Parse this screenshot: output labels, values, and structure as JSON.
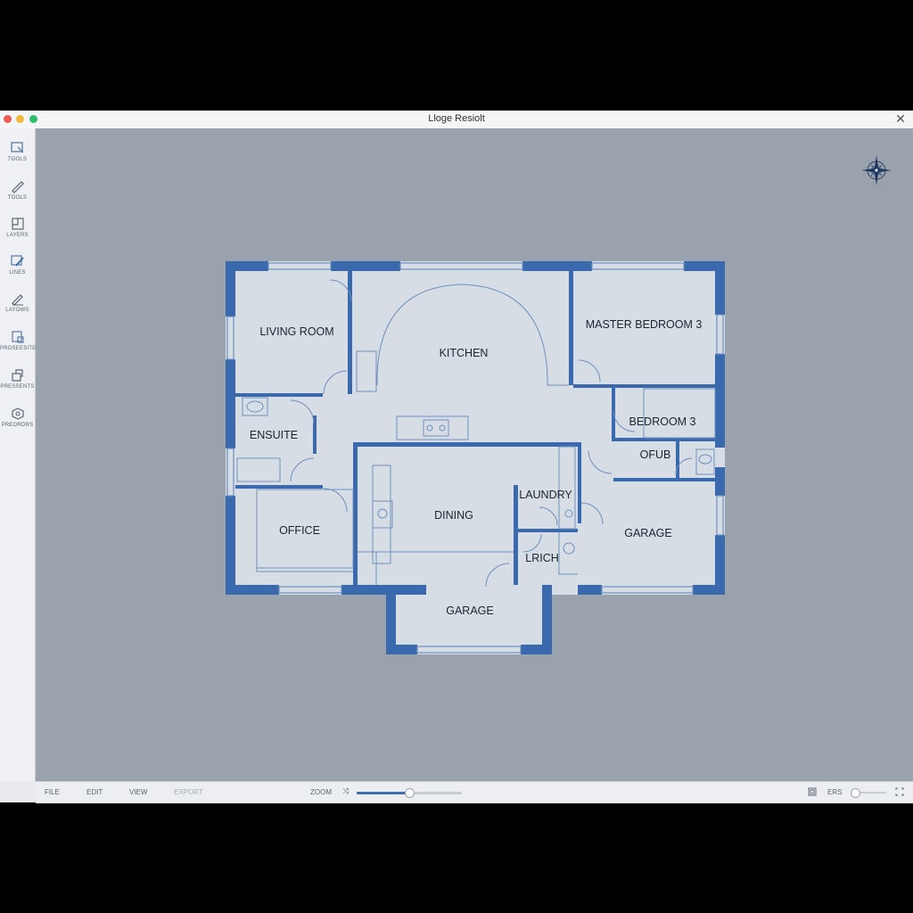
{
  "window": {
    "title": "Lloge Resiolt"
  },
  "sidebar": {
    "tools": [
      {
        "icon": "select-tool-icon",
        "label": "TOOLS"
      },
      {
        "icon": "pencil-icon",
        "label": "TOOLS"
      },
      {
        "icon": "layers-icon",
        "label": "LAYERS"
      },
      {
        "icon": "line-tool-icon",
        "label": "LINES"
      },
      {
        "icon": "edit-icon",
        "label": "LAYOWS"
      },
      {
        "icon": "properties-icon",
        "label": "PROSEESITES"
      },
      {
        "icon": "presets-icon",
        "label": "PRESSENTS"
      },
      {
        "icon": "preferences-icon",
        "label": "PREORDRS"
      }
    ]
  },
  "rooms": {
    "living_room": "LIVING ROOM",
    "kitchen": "KITCHEN",
    "master_bedroom": "MASTER BEDROOM 3",
    "ensuite": "ENSUITE",
    "bedroom": "BEDROOM 3",
    "office_small": "OFUB",
    "office": "OFFICE",
    "dining": "DINING",
    "laundry": "LAUNDRY",
    "lrich": "LRICH",
    "garage_right": "GARAGE",
    "garage_bottom": "GARAGE"
  },
  "bottombar": {
    "menus": [
      "FILE",
      "EDIT",
      "VIEW",
      "EXPORT"
    ],
    "zoom_label": "ZOOM",
    "zoom_value": 0.5,
    "ers_label": "ERS",
    "secondary_value": 0.0
  },
  "colors": {
    "wall": "#3a69ad",
    "floor": "#d7dde4",
    "canvas": "#9aa3ad",
    "accent": "#3e6eab"
  }
}
